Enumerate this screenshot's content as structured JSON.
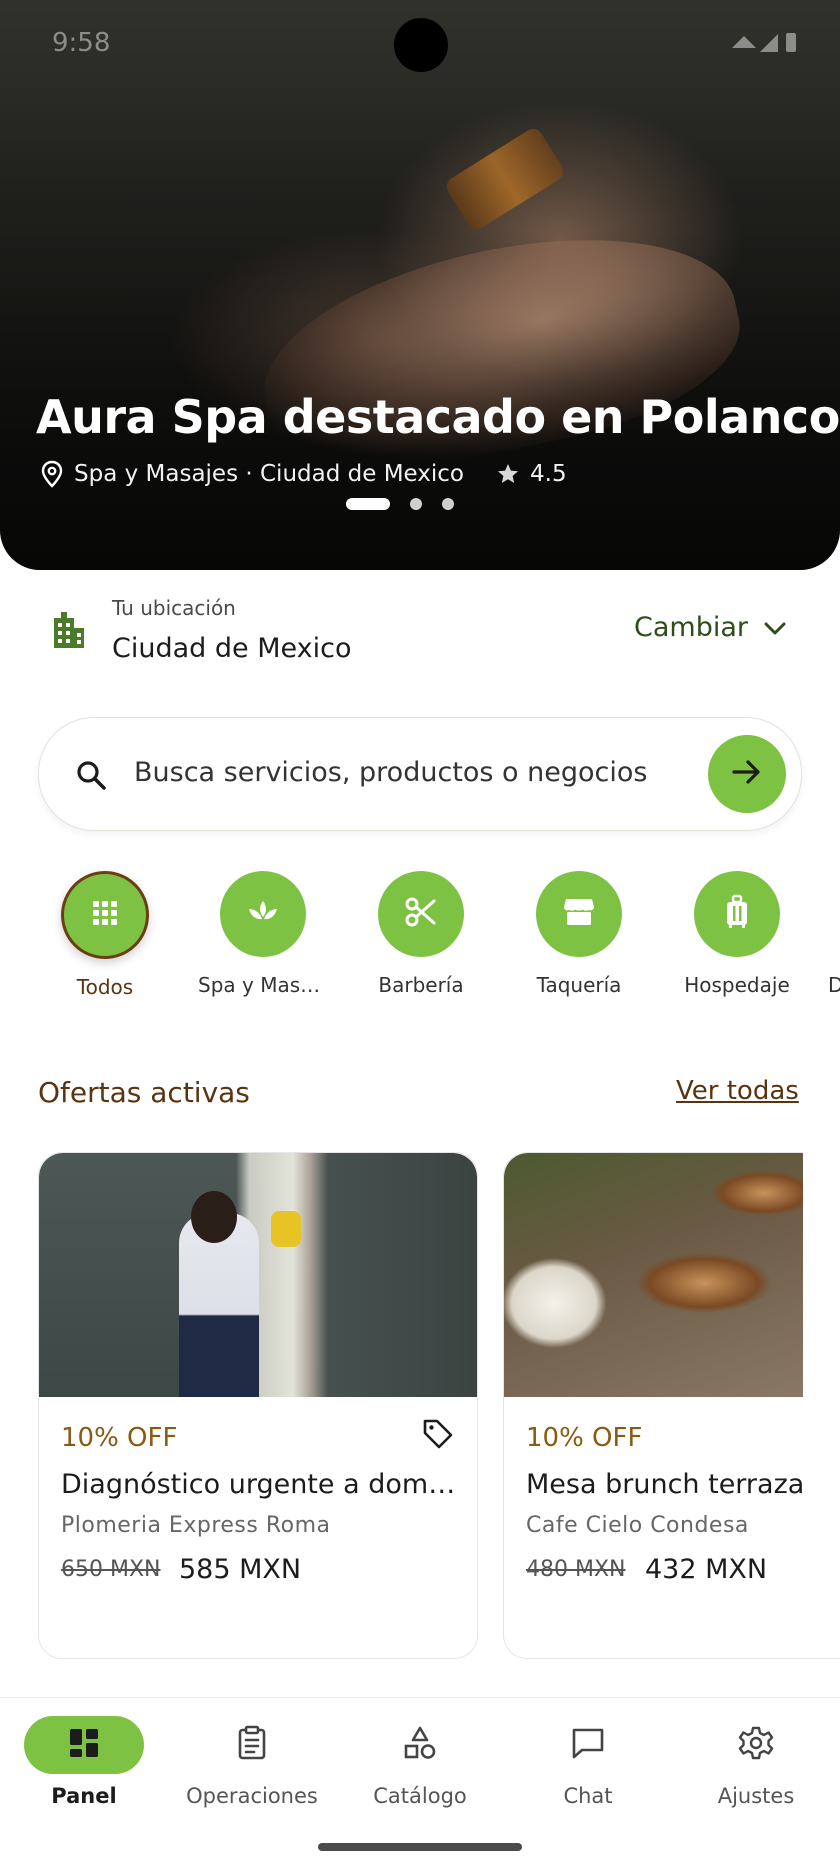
{
  "status_bar": {
    "time": "9:58"
  },
  "hero": {
    "title": "Aura Spa destacado en Polanco",
    "category_location": "Spa y Masajes · Ciudad de Mexico",
    "rating": "4.5",
    "carousel_pages": 3,
    "carousel_active": 1
  },
  "location": {
    "label": "Tu ubicación",
    "value": "Ciudad de Mexico",
    "change_label": "Cambiar"
  },
  "search": {
    "placeholder": "Busca servicios, productos o negocios"
  },
  "categories": [
    {
      "label": "Todos",
      "icon": "grid-icon",
      "active": true
    },
    {
      "label": "Spa y Masaj...",
      "icon": "lotus-icon",
      "active": false
    },
    {
      "label": "Barbería",
      "icon": "scissors-icon",
      "active": false
    },
    {
      "label": "Taquería",
      "icon": "store-icon",
      "active": false
    },
    {
      "label": "Hospedaje",
      "icon": "luggage-icon",
      "active": false
    },
    {
      "label": "D",
      "icon": "",
      "active": false
    }
  ],
  "offers": {
    "title": "Ofertas activas",
    "see_all": "Ver todas",
    "items": [
      {
        "discount": "10% OFF",
        "title": "Diagnóstico urgente a domicilio",
        "business": "Plomeria Express Roma",
        "old_price": "650 MXN",
        "new_price": "585 MXN"
      },
      {
        "discount": "10% OFF",
        "title": "Mesa brunch terraza",
        "business": "Cafe Cielo Condesa",
        "old_price": "480 MXN",
        "new_price": "432 MXN"
      }
    ]
  },
  "bottom_nav": [
    {
      "label": "Panel",
      "icon": "dashboard-icon",
      "active": true
    },
    {
      "label": "Operaciones",
      "icon": "clipboard-icon",
      "active": false
    },
    {
      "label": "Catálogo",
      "icon": "shapes-icon",
      "active": false
    },
    {
      "label": "Chat",
      "icon": "chat-icon",
      "active": false
    },
    {
      "label": "Ajustes",
      "icon": "gear-icon",
      "active": false
    }
  ],
  "colors": {
    "accent_green": "#7dc242",
    "brown_text": "#5a3410",
    "dark_green_text": "#2f4d1a"
  }
}
